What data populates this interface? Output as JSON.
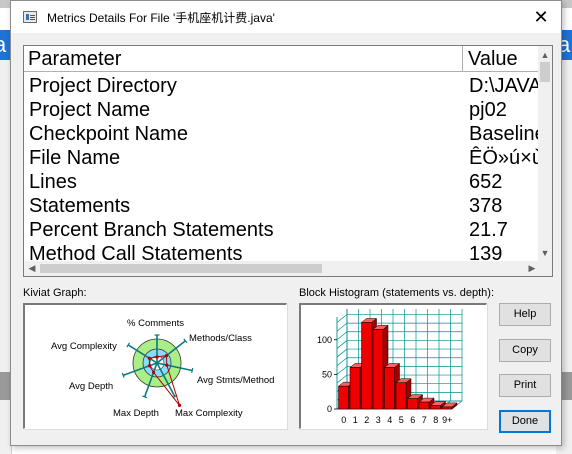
{
  "background": {
    "left_fragment": "a",
    "right_fragment": "a"
  },
  "titlebar": {
    "title": "Metrics Details For File '手机座机计费.java'",
    "close_glyph": "✕",
    "icon": "metrics-window-icon"
  },
  "table": {
    "columns": [
      "Parameter",
      "Value"
    ],
    "rows": [
      {
        "parameter": "Project Directory",
        "value": "D:\\JAVA"
      },
      {
        "parameter": "Project Name",
        "value": "pj02"
      },
      {
        "parameter": "Checkpoint Name",
        "value": "Baseline"
      },
      {
        "parameter": "File Name",
        "value": "ÊÖ»ú×ù"
      },
      {
        "parameter": "Lines",
        "value": "652"
      },
      {
        "parameter": "Statements",
        "value": "378"
      },
      {
        "parameter": "Percent Branch Statements",
        "value": "21.7"
      },
      {
        "parameter": "Method Call Statements",
        "value": "139"
      }
    ]
  },
  "kiviat": {
    "label": "Kiviat Graph:",
    "axes": [
      "% Comments",
      "Methods/Class",
      "Avg Stmts/Method",
      "Max Complexity",
      "Max Depth",
      "Avg Depth",
      "Avg Complexity"
    ],
    "colors": {
      "outer_band": "#aaee88",
      "inner_band": "#88ddff",
      "axis": "#0a7a7a",
      "plot": "#b00000"
    }
  },
  "histogram": {
    "label": "Block Histogram (statements vs. depth):",
    "bar_color": "#ee0000",
    "grid_color": "#009090",
    "chart_data": {
      "type": "bar",
      "categories": [
        "0",
        "1",
        "2",
        "3",
        "4",
        "5",
        "6",
        "7",
        "8",
        "9+"
      ],
      "values": [
        33,
        60,
        125,
        115,
        60,
        38,
        15,
        10,
        5,
        3
      ],
      "ylim": [
        0,
        130
      ],
      "yticks": [
        "0",
        "50",
        "100"
      ]
    }
  },
  "buttons": {
    "help": "Help",
    "copy": "Copy",
    "print": "Print",
    "done": "Done"
  },
  "scroll": {
    "up": "▲",
    "down": "▼",
    "left": "◀",
    "right": "▶"
  }
}
